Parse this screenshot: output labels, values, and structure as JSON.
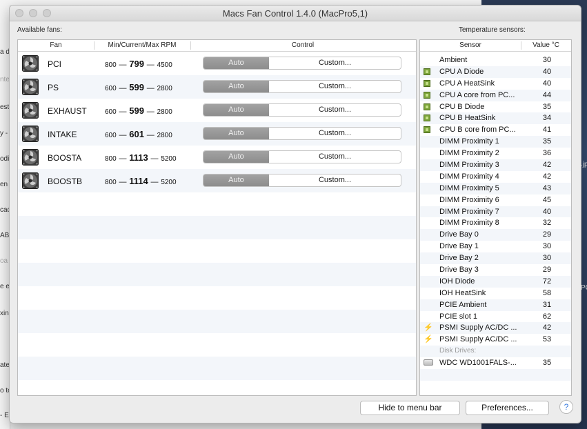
{
  "window": {
    "title": "Macs Fan Control 1.4.0 (MacPro5,1)"
  },
  "fans_section": {
    "label": "Available fans:",
    "headers": {
      "fan": "Fan",
      "rpm": "Min/Current/Max RPM",
      "control": "Control"
    },
    "fans": [
      {
        "name": "PCI",
        "min": "800",
        "current": "799",
        "max": "4500",
        "mode_auto": "Auto",
        "mode_custom": "Custom..."
      },
      {
        "name": "PS",
        "min": "600",
        "current": "599",
        "max": "2800",
        "mode_auto": "Auto",
        "mode_custom": "Custom..."
      },
      {
        "name": "EXHAUST",
        "min": "600",
        "current": "599",
        "max": "2800",
        "mode_auto": "Auto",
        "mode_custom": "Custom..."
      },
      {
        "name": "INTAKE",
        "min": "600",
        "current": "601",
        "max": "2800",
        "mode_auto": "Auto",
        "mode_custom": "Custom..."
      },
      {
        "name": "BOOSTA",
        "min": "800",
        "current": "1113",
        "max": "5200",
        "mode_auto": "Auto",
        "mode_custom": "Custom..."
      },
      {
        "name": "BOOSTB",
        "min": "800",
        "current": "1114",
        "max": "5200",
        "mode_auto": "Auto",
        "mode_custom": "Custom..."
      }
    ],
    "dash": "—"
  },
  "temp_section": {
    "label": "Temperature sensors:",
    "headers": {
      "sensor": "Sensor",
      "value": "Value °C"
    },
    "sensors": [
      {
        "name": "Ambient",
        "value": "30",
        "icon": "none"
      },
      {
        "name": "CPU A Diode",
        "value": "40",
        "icon": "cpu-chip-icon"
      },
      {
        "name": "CPU A HeatSink",
        "value": "40",
        "icon": "cpu-chip-icon"
      },
      {
        "name": "CPU A core from PC...",
        "value": "44",
        "icon": "cpu-chip-icon"
      },
      {
        "name": "CPU B Diode",
        "value": "35",
        "icon": "cpu-chip-icon"
      },
      {
        "name": "CPU B HeatSink",
        "value": "34",
        "icon": "cpu-chip-icon"
      },
      {
        "name": "CPU B core from PC...",
        "value": "41",
        "icon": "cpu-chip-icon"
      },
      {
        "name": "DIMM Proximity 1",
        "value": "35",
        "icon": "none"
      },
      {
        "name": "DIMM Proximity 2",
        "value": "36",
        "icon": "none"
      },
      {
        "name": "DIMM Proximity 3",
        "value": "42",
        "icon": "none"
      },
      {
        "name": "DIMM Proximity 4",
        "value": "42",
        "icon": "none"
      },
      {
        "name": "DIMM Proximity 5",
        "value": "43",
        "icon": "none"
      },
      {
        "name": "DIMM Proximity 6",
        "value": "45",
        "icon": "none"
      },
      {
        "name": "DIMM Proximity 7",
        "value": "40",
        "icon": "none"
      },
      {
        "name": "DIMM Proximity 8",
        "value": "32",
        "icon": "none"
      },
      {
        "name": "Drive Bay 0",
        "value": "29",
        "icon": "none"
      },
      {
        "name": "Drive Bay 1",
        "value": "30",
        "icon": "none"
      },
      {
        "name": "Drive Bay 2",
        "value": "30",
        "icon": "none"
      },
      {
        "name": "Drive Bay 3",
        "value": "29",
        "icon": "none"
      },
      {
        "name": "IOH Diode",
        "value": "72",
        "icon": "none"
      },
      {
        "name": "IOH HeatSink",
        "value": "58",
        "icon": "none"
      },
      {
        "name": "PCIE Ambient",
        "value": "31",
        "icon": "none"
      },
      {
        "name": "PCIE slot 1",
        "value": "62",
        "icon": "none"
      },
      {
        "name": "PSMI Supply AC/DC ...",
        "value": "42",
        "icon": "power-bolt-icon"
      },
      {
        "name": "PSMI Supply AC/DC ...",
        "value": "53",
        "icon": "power-bolt-icon"
      },
      {
        "name": "Disk Drives:",
        "value": "",
        "icon": "group"
      },
      {
        "name": "WDC WD1001FALS-...",
        "value": "35",
        "icon": "hard-drive-icon"
      }
    ]
  },
  "buttons": {
    "hide_to_menu_bar": "Hide to menu bar",
    "preferences": "Preferences...",
    "help": "?"
  },
  "background_fragments": [
    "a d",
    "nte",
    "est",
    "y -",
    "odi",
    "en",
    "cac",
    "AB(",
    "oa",
    "e er",
    "xin",
    "ate",
    "o to",
    "- E"
  ],
  "background_right_fragments": [
    ".jp",
    "PG"
  ]
}
